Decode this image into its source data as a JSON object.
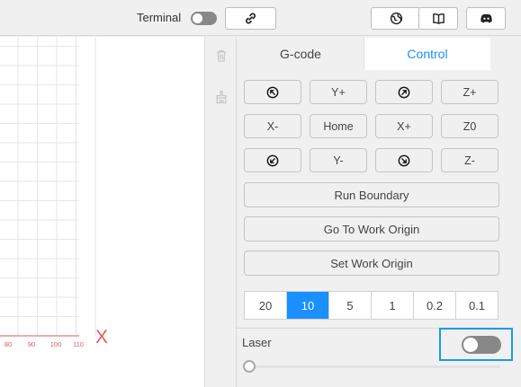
{
  "topbar": {
    "terminal_label": "Terminal",
    "terminal_toggle_on": false,
    "icons": [
      "link-icon",
      "globe-icon",
      "book-icon",
      "discord-icon"
    ]
  },
  "canvas": {
    "x_axis_label": "X",
    "x_ticks": [
      "80",
      "90",
      "100",
      "110"
    ],
    "axis_color": "#e05a5a"
  },
  "panel": {
    "tabs": [
      {
        "label": "G-code",
        "active": false
      },
      {
        "label": "Control",
        "active": true
      }
    ],
    "jog": {
      "row1": [
        "",
        "Y+",
        "",
        "Z+"
      ],
      "row2": [
        "X-",
        "Home",
        "X+",
        "Z0"
      ],
      "row3": [
        "",
        "Y-",
        "",
        "Z-"
      ]
    },
    "buttons": {
      "run_boundary": "Run Boundary",
      "go_to_work_origin": "Go To Work Origin",
      "set_work_origin": "Set Work Origin"
    },
    "steps": [
      "20",
      "10",
      "5",
      "1",
      "0.2",
      "0.1"
    ],
    "active_step": "10",
    "laser_label": "Laser",
    "laser_on": false,
    "laser_power": 0
  },
  "colors": {
    "accent": "#1a90ff",
    "highlight_border": "#1a9be6"
  }
}
